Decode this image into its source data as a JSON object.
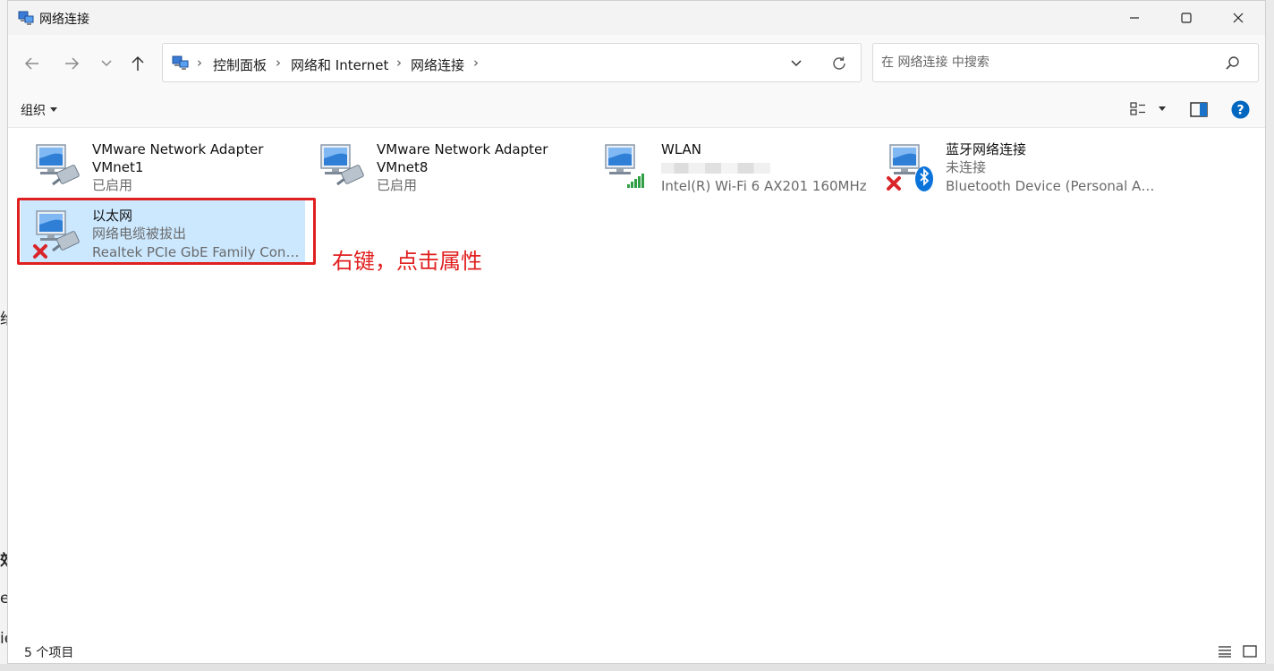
{
  "window": {
    "title": "网络连接",
    "minimize_glyph": "—",
    "maximize_glyph": "☐",
    "close_glyph": "✕"
  },
  "background_fragments": [
    "给",
    "效",
    "e",
    "ie"
  ],
  "nav": {
    "breadcrumbs": [
      "控制面板",
      "网络和 Internet",
      "网络连接"
    ],
    "search_placeholder": "在 网络连接 中搜索"
  },
  "commands": {
    "organize_label": "组织"
  },
  "connections": [
    {
      "name": "VMware Network Adapter VMnet1",
      "line1": "VMware Network Adapter",
      "line2": "VMnet1",
      "status": "已启用",
      "icon": "ethernet-adapter-icon",
      "badge": "network-cable-icon"
    },
    {
      "name": "VMware Network Adapter VMnet8",
      "line1": "VMware Network Adapter",
      "line2": "VMnet8",
      "status": "已启用",
      "icon": "ethernet-adapter-icon",
      "badge": "network-cable-icon"
    },
    {
      "name": "WLAN",
      "status": "",
      "device": "Intel(R) Wi-Fi 6 AX201 160MHz",
      "icon": "wifi-adapter-icon",
      "badge": "wifi-signal-icon"
    },
    {
      "name": "蓝牙网络连接",
      "status": "未连接",
      "device": "Bluetooth Device (Personal Ar...",
      "icon": "bluetooth-adapter-icon",
      "badge": "bluetooth-icon"
    },
    {
      "name": "以太网",
      "status": "网络电缆被拔出",
      "device": "Realtek PCIe GbE Family Contr...",
      "icon": "ethernet-adapter-icon",
      "badge": "network-cable-icon",
      "selected": true
    }
  ],
  "annotation": {
    "text": "右键，点击属性",
    "color": "#e02020"
  },
  "status": {
    "item_count": "5 个项目"
  },
  "colors": {
    "selection": "#cce8ff",
    "accent": "#0067c0",
    "error_x": "#d9262a",
    "signal_green": "#2f9e44"
  }
}
